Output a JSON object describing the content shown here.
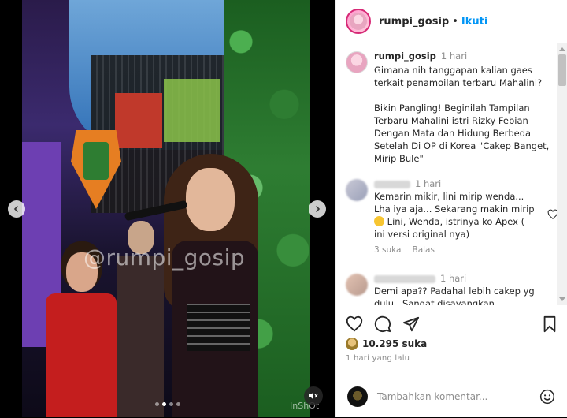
{
  "header": {
    "username": "rumpi_gosip",
    "separator": "•",
    "follow_label": "Ikuti"
  },
  "media": {
    "watermark": "@rumpi_gosip",
    "footer_mark": "InShOt",
    "carousel_total": 4,
    "carousel_active_index": 1
  },
  "caption": {
    "username": "rumpi_gosip",
    "time": "1 hari",
    "text": "Gimana nih tanggapan kalian gaes terkait penamoilan terbaru Mahalini?\n\nBikin Pangling! Beginilah Tampilan Terbaru Mahalini istri Rizky Febian Dengan Mata dan Hidung Berbeda Setelah Di OP di Korea \"Cakep Banget, Mirip Bule\""
  },
  "comments": [
    {
      "time": "1 hari",
      "text_line1": "Kemarin mikir, lini mirip wenda...",
      "text_line2": "Lha iya aja... Sekarang makin mirip",
      "text_line3": " Lini, Wenda, istrinya ko Apex (",
      "text_line4": "ini versi original nya)",
      "likes_label": "3 suka",
      "reply_label": "Balas"
    },
    {
      "time": "1 hari",
      "text_line1": "Demi apa?? Padahal lebih cakep yg",
      "text_line2": "dulu . Sangat disayangkan"
    }
  ],
  "post": {
    "likes": "10.295 suka",
    "date": "1 hari yang lalu"
  },
  "composer": {
    "placeholder": "Tambahkan komentar..."
  },
  "icons": {
    "nav_prev": "chevron-left-icon",
    "nav_next": "chevron-right-icon",
    "mute": "speaker-muted-icon",
    "more": "more-options-icon",
    "like": "heart-icon",
    "comment": "comment-icon",
    "share": "send-icon",
    "save": "bookmark-icon",
    "emoji": "emoji-icon"
  },
  "colors": {
    "accent": "#0095f6",
    "text": "#262626",
    "muted": "#8e8e8e"
  }
}
